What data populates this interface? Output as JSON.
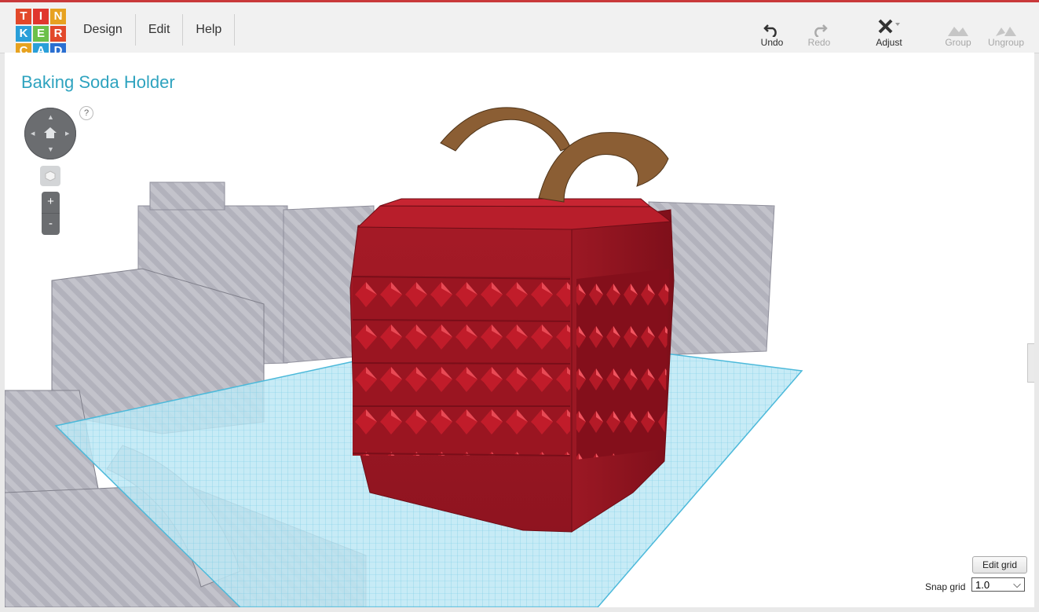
{
  "app": {
    "logo": [
      "T",
      "I",
      "N",
      "K",
      "E",
      "R",
      "C",
      "A",
      "D"
    ],
    "logo_colors": [
      "#e2482a",
      "#e0362e",
      "#e7a220",
      "#2a9fd9",
      "#6cc04a",
      "#e2482a",
      "#e7a220",
      "#2a9fd9",
      "#2a6fd1"
    ]
  },
  "menu": {
    "design": "Design",
    "edit": "Edit",
    "help": "Help"
  },
  "toolbar": {
    "undo": "Undo",
    "redo": "Redo",
    "adjust": "Adjust",
    "group": "Group",
    "ungroup": "Ungroup"
  },
  "project": {
    "title": "Baking Soda Holder"
  },
  "controls": {
    "help": "?",
    "zoom_in": "+",
    "zoom_out": "-"
  },
  "grid": {
    "edit_grid_label": "Edit grid",
    "snap_grid_label": "Snap grid",
    "snap_grid_value": "1.0"
  },
  "scene": {
    "main_object_color": "#9e1722",
    "workplane_color": "#7fd3ea",
    "ghost_color": "#9a9aa6",
    "stem_color": "#8b5e34"
  }
}
